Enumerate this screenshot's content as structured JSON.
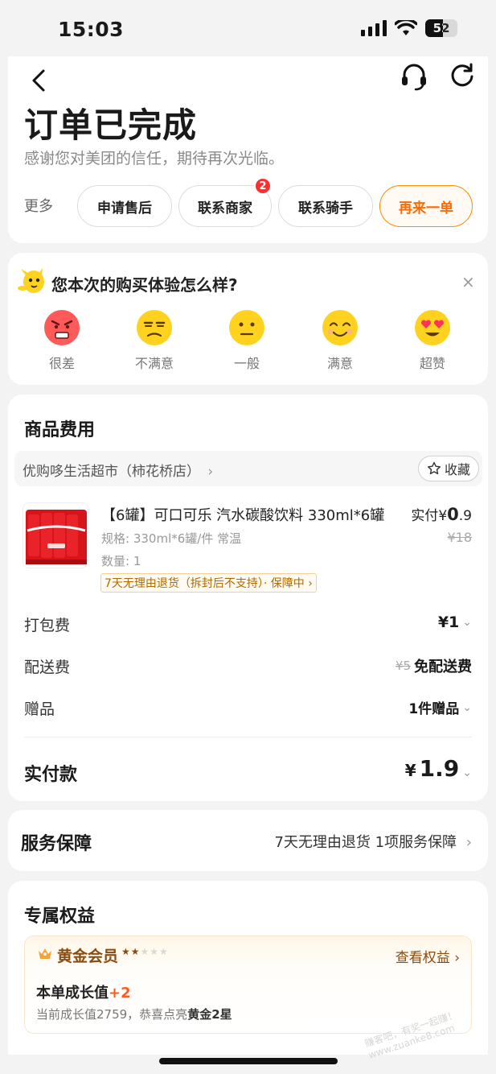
{
  "status_bar": {
    "time": "15:03",
    "battery": "52"
  },
  "header": {
    "title": "订单已完成",
    "subtitle": "感谢您对美团的信任，期待再次光临。",
    "more_label": "更多",
    "actions": [
      {
        "label": "申请售后"
      },
      {
        "label": "联系商家",
        "badge": "2"
      },
      {
        "label": "联系骑手"
      },
      {
        "label": "再来一单"
      }
    ],
    "accent_color": "#ff6a00"
  },
  "rating": {
    "question": "您本次的购买体验怎么样?",
    "close": "×",
    "options": [
      {
        "label": "很差",
        "icon": "angry-face-icon"
      },
      {
        "label": "不满意",
        "icon": "unamused-face-icon"
      },
      {
        "label": "一般",
        "icon": "neutral-face-icon"
      },
      {
        "label": "满意",
        "icon": "smiling-face-icon"
      },
      {
        "label": "超赞",
        "icon": "heart-eyes-face-icon"
      }
    ]
  },
  "goods": {
    "section_title": "商品费用",
    "store_name": "优购哆生活超市（柿花桥店）",
    "store_chevron": "›",
    "favorite_label": "收藏",
    "product": {
      "name": "【6罐】可口可乐 汽水碳酸饮料 330ml*6罐",
      "spec": "规格: 330ml*6罐/件 常温",
      "quantity": "数量: 1",
      "tag": "7天无理由退货（拆封后不支持）· 保障中 ›",
      "paid_prefix": "实付",
      "paid_currency": "¥",
      "paid_int": "0",
      "paid_dec": ".9",
      "original_price": "¥18"
    },
    "fees": [
      {
        "label": "打包费",
        "value": "¥1",
        "strike": ""
      },
      {
        "label": "配送费",
        "value": "免配送费",
        "strike": "¥5"
      },
      {
        "label": "赠品",
        "value": "1件赠品",
        "strike": ""
      }
    ],
    "total_label": "实付款",
    "total_currency": "¥",
    "total_value": "1.9"
  },
  "service": {
    "title": "服务保障",
    "value": "7天无理由退货 1项服务保障",
    "chevron": "›"
  },
  "benefits": {
    "title": "专属权益",
    "member_level": "黄金会员",
    "stars": "★★★★★",
    "view_link": "查看权益 ›",
    "growth_label": "本单成长值",
    "growth_plus": "+2",
    "growth_desc_prefix": "当前成长值2759，恭喜点亮",
    "growth_desc_bold": "黄金2星"
  },
  "watermark": "赚客吧，有奖一起赚！ www.zuanke8.com"
}
